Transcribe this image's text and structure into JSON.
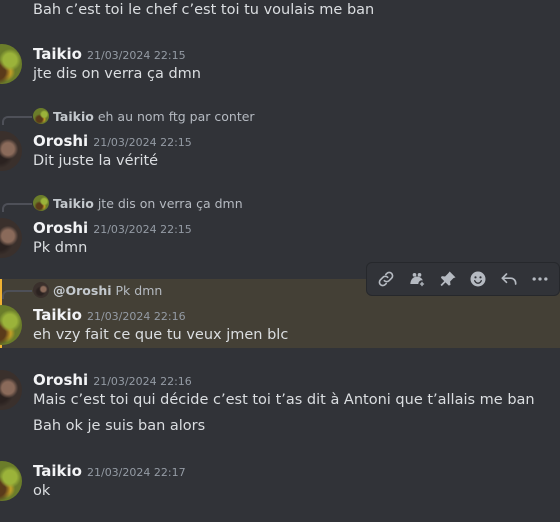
{
  "messages": [
    {
      "text": "Bah c’est toi le chef c’est toi tu voulais me ban"
    },
    {
      "author": "Taikio",
      "timestamp": "21/03/2024 22:15",
      "text": "jte dis on verra ça dmn"
    },
    {
      "reply_author": "Taikio",
      "reply_text": "eh au nom ftg par conter",
      "author": "Oroshi",
      "timestamp": "21/03/2024 22:15",
      "text": "Dit juste la vérité"
    },
    {
      "reply_author": "Taikio",
      "reply_text": "jte dis on verra ça dmn",
      "author": "Oroshi",
      "timestamp": "21/03/2024 22:15",
      "text": "Pk dmn"
    },
    {
      "reply_author": "@Oroshi",
      "reply_text": "Pk dmn",
      "author": "Taikio",
      "timestamp": "21/03/2024 22:16",
      "text": "eh vzy fait ce que tu veux jmen blc"
    },
    {
      "author": "Oroshi",
      "timestamp": "21/03/2024 22:16",
      "text": "Mais c’est toi qui décide c’est toi t’as dit à Antoni que t’allais me ban",
      "text2": "Bah ok je suis ban alors"
    },
    {
      "author": "Taikio",
      "timestamp": "21/03/2024 22:17",
      "text": "ok"
    }
  ],
  "toolbar": {
    "icons": [
      "link-icon",
      "add-reaction-icon",
      "pin-icon",
      "emoji-icon",
      "reply-icon",
      "more-icon"
    ]
  },
  "colors": {
    "mention_bar": "#f0b232",
    "mention_bg": "#444036",
    "background": "#313338"
  }
}
